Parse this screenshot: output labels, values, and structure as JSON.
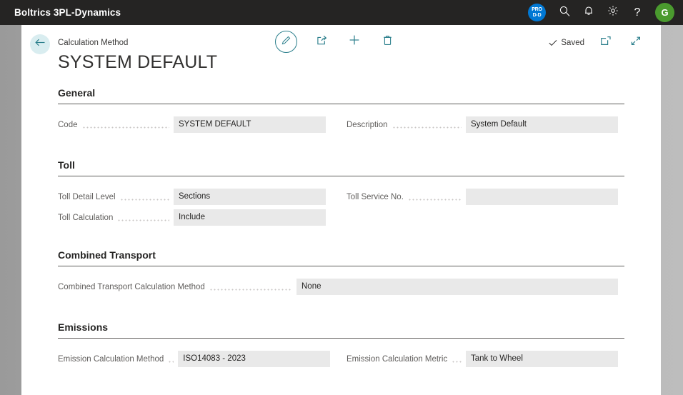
{
  "appbar": {
    "title": "Boltrics 3PL-Dynamics",
    "env_badge_line1": "PRO",
    "env_badge_line2": "D-D",
    "search_icon": "search-icon",
    "notification_icon": "bell-icon",
    "settings_icon": "gear-icon",
    "help_icon": "question-mark-icon",
    "avatar_initial": "G"
  },
  "header": {
    "breadcrumb": "Calculation Method",
    "title": "SYSTEM DEFAULT",
    "back_icon": "back-arrow-icon",
    "actions": [
      {
        "name": "edit-button",
        "icon": "pencil-icon"
      },
      {
        "name": "share-button",
        "icon": "share-icon"
      },
      {
        "name": "new-button",
        "icon": "plus-icon"
      },
      {
        "name": "delete-button",
        "icon": "trash-icon"
      }
    ],
    "saved_label": "Saved",
    "open-in-new-icon": "open-in-new-window-icon",
    "minimize_icon": "collapse-icon"
  },
  "sections": [
    {
      "title": "General",
      "rows": [
        {
          "left": {
            "label": "Code",
            "value": "SYSTEM DEFAULT"
          },
          "right": {
            "label": "Description",
            "value": "System Default"
          }
        }
      ]
    },
    {
      "title": "Toll",
      "rows": [
        {
          "left": {
            "label": "Toll Detail Level",
            "value": "Sections"
          },
          "right": {
            "label": "Toll Service No.",
            "value": ""
          }
        },
        {
          "left": {
            "label": "Toll Calculation",
            "value": "Include"
          },
          "right": null
        }
      ]
    },
    {
      "title": "Combined Transport",
      "rows": [
        {
          "full": {
            "label": "Combined Transport Calculation Method",
            "value": "None"
          }
        }
      ]
    },
    {
      "title": "Emissions",
      "rows": [
        {
          "left": {
            "label": "Emission Calculation Method",
            "value": "ISO14083 - 2023"
          },
          "right": {
            "label": "Emission Calculation Metric",
            "value": "Tank to Wheel"
          }
        }
      ]
    }
  ],
  "colors": {
    "appbar_bg": "#252423",
    "accent_teal": "#2b7f8c",
    "field_bg": "#e9e9e9",
    "env_badge_bg": "#0078d4",
    "avatar_bg": "#4a9a2e"
  }
}
